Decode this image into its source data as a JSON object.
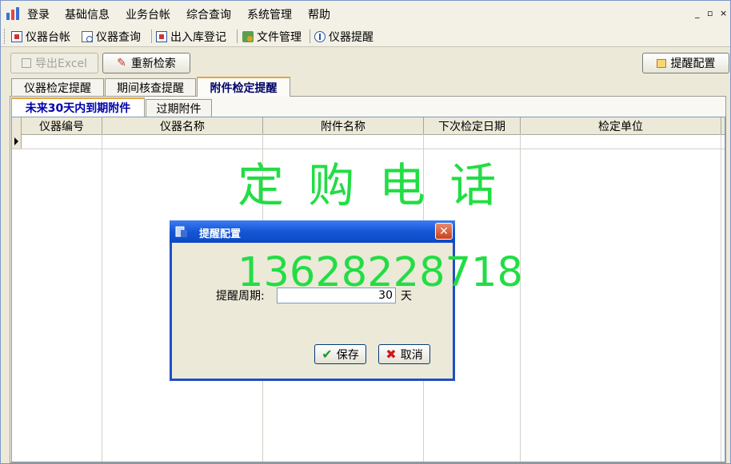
{
  "menu": [
    "登录",
    "基础信息",
    "业务台帐",
    "综合查询",
    "系统管理",
    "帮助"
  ],
  "window_controls": [
    "_",
    "▫",
    "×"
  ],
  "toolbar": [
    {
      "label": "仪器台帐",
      "icon": "ledger-icon"
    },
    {
      "label": "仪器查询",
      "icon": "query-icon"
    },
    {
      "label": "出入库登记",
      "icon": "register-icon"
    },
    {
      "label": "文件管理",
      "icon": "file-icon"
    },
    {
      "label": "仪器提醒",
      "icon": "reminder-icon"
    }
  ],
  "actions": {
    "export": "导出Excel",
    "research": "重新检索",
    "reminder_config": "提醒配置"
  },
  "tabs": [
    "仪器检定提醒",
    "期间核查提醒",
    "附件检定提醒"
  ],
  "active_tab": 2,
  "subtabs": [
    "未来30天内到期附件",
    "过期附件"
  ],
  "active_subtab": 0,
  "grid": {
    "columns": [
      "仪器编号",
      "仪器名称",
      "附件名称",
      "下次检定日期",
      "检定单位"
    ]
  },
  "watermark": {
    "line1": "定 购 电 话",
    "line2": "13628228718"
  },
  "dialog": {
    "title": "提醒配置",
    "label": "提醒周期:",
    "value": "30",
    "unit": "天",
    "save": "保存",
    "cancel": "取消"
  },
  "colors": {
    "watermark": "#22dd44",
    "title_bar": "#1556d6",
    "active_tab_text": "#000066",
    "active_subtab_text": "#0000aa"
  }
}
